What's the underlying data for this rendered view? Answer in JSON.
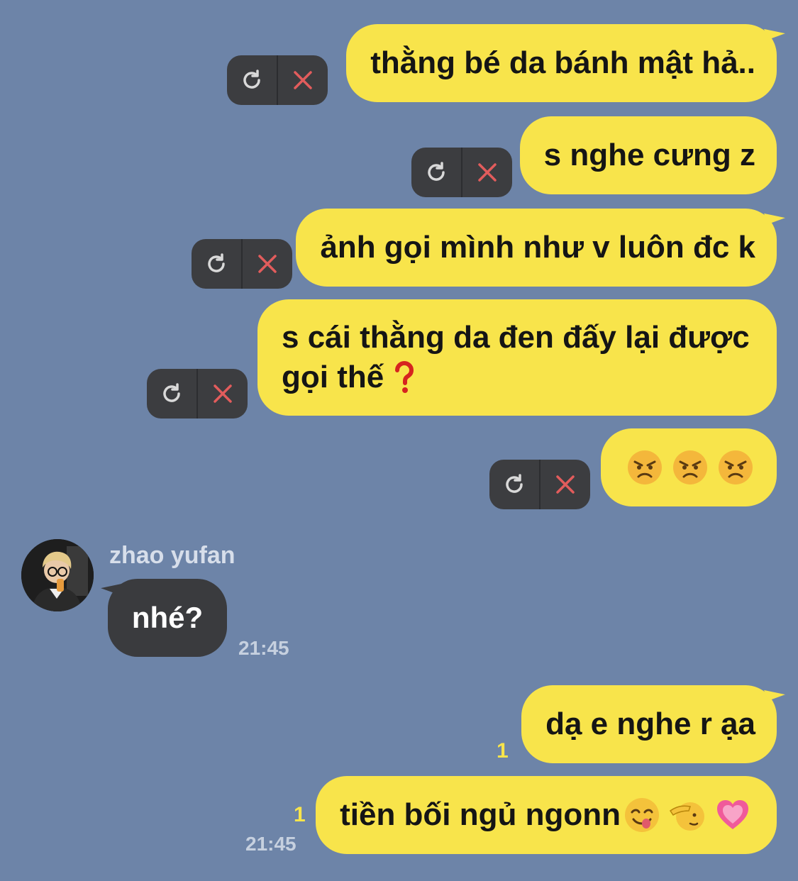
{
  "messages_out_top": [
    {
      "text": "thằng bé da bánh mật hả.."
    },
    {
      "text": "s nghe cưng z"
    },
    {
      "text": "ảnh gọi mình như v luôn đc k"
    },
    {
      "line1": "s cái thằng da đen đấy lại được",
      "line2": "gọi thế",
      "line2_icon": "red-question-mark-icon"
    },
    {
      "icons": [
        "angry-face-icon",
        "angry-face-icon",
        "angry-face-icon"
      ]
    }
  ],
  "incoming": {
    "sender": "zhao yufan",
    "text": "nhé?",
    "time": "21:45"
  },
  "messages_out_bottom": [
    {
      "text": "dạ e nghe r ạa",
      "read": "1"
    },
    {
      "text": "tiền bối ngủ ngonn",
      "read": "1",
      "time": "21:45",
      "icons": [
        "yum-face-icon",
        "saluting-face-icon",
        "growing-heart-icon"
      ]
    }
  ],
  "actions": {
    "retry_icon": "refresh-icon",
    "cancel_icon": "close-icon"
  },
  "colors": {
    "background": "#6d84a8",
    "outgoing_bubble": "#f8e44b",
    "incoming_bubble": "#3a3b3e",
    "action_pill": "#3c3d40",
    "cancel_x": "#e25c5c",
    "read_count": "#f8e44b"
  }
}
